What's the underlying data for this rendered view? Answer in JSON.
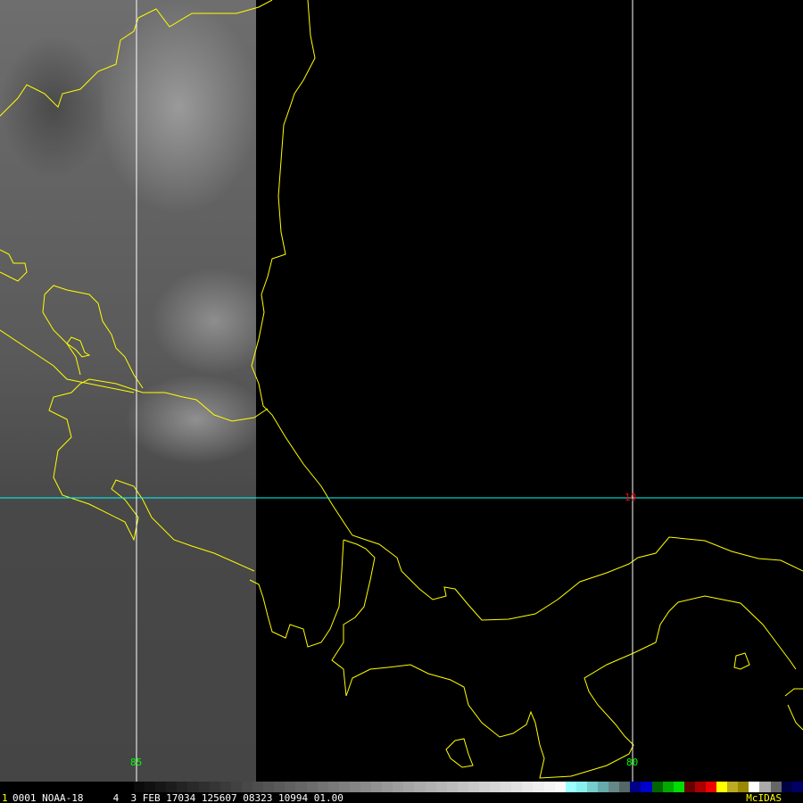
{
  "satellite_info": {
    "frame": "1",
    "line": "0001 NOAA-18     4  3 FEB 17034 125607 08323 10994 01.00",
    "brand": "McIDAS"
  },
  "grid_labels": {
    "lat_10": "10",
    "lon_85": "85",
    "lon_80": "80"
  },
  "colors": {
    "coast": "#ffff00",
    "lat_line": "#00ffff",
    "lon_line": "#ffffff",
    "lon_label": "#00ff00",
    "lat_label": "#ff0000"
  }
}
